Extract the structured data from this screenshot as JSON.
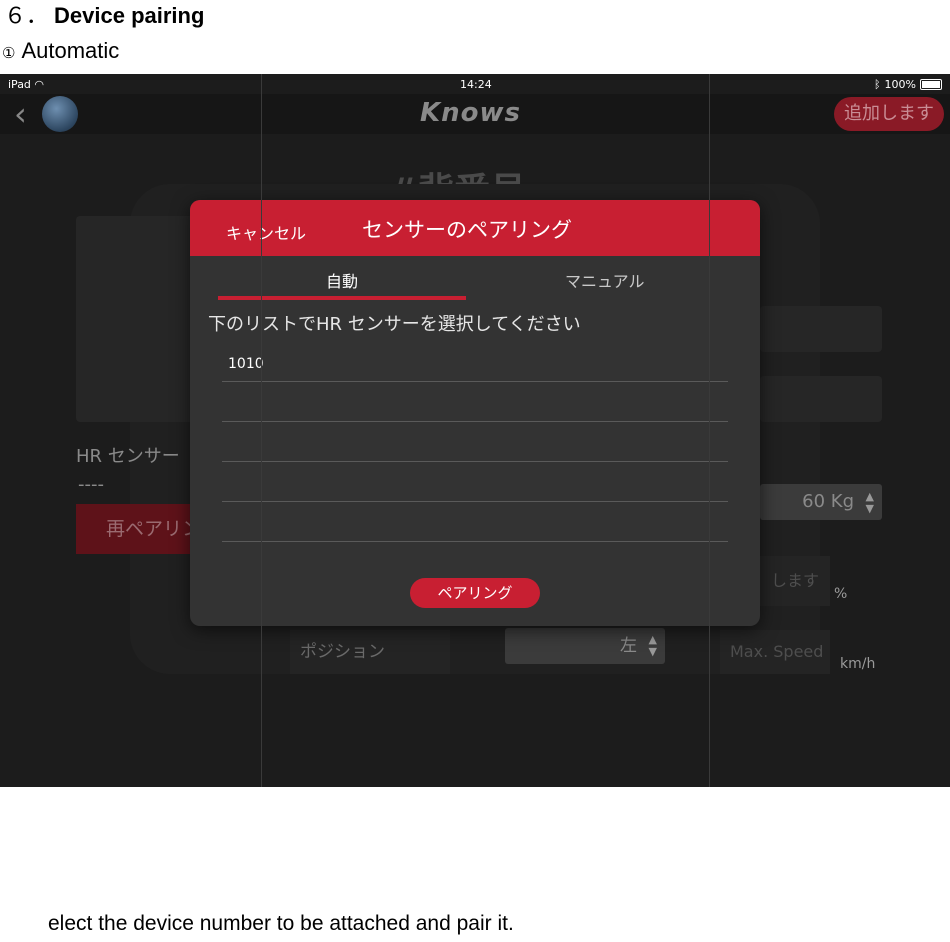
{
  "doc": {
    "heading_number": "６．",
    "heading_text": "Device pairing",
    "sub_marker": "①",
    "sub_text": "Automatic",
    "caption": "elect the device number to be attached and pair it."
  },
  "statusbar": {
    "device": "iPad",
    "time": "14:24",
    "battery": "100%"
  },
  "navbar": {
    "back_icon": "chevron-left-icon",
    "logo": "Knows",
    "add_button": "追加します"
  },
  "background": {
    "title": "#背番号",
    "hr_sensor_label": "HR センサー",
    "hr_sensor_value": "----",
    "repair_button": "再ペアリン",
    "weight_value": "60 Kg",
    "percent_unit": "%",
    "speed_unit": "km/h",
    "position_label": "ポジション",
    "side_value": "左",
    "max_speed_placeholder": "Max. Speed",
    "masu_fragment": "します"
  },
  "dialog": {
    "cancel": "キャンセル",
    "title": "センサーのペアリング",
    "tabs": [
      {
        "label": "自動",
        "active": true
      },
      {
        "label": "マニュアル",
        "active": false
      }
    ],
    "instruction": "下のリストでHR センサーを選択してください",
    "devices": [
      "1010",
      "",
      "",
      "",
      ""
    ],
    "pair_button": "ペアリング"
  },
  "colors": {
    "accent_red": "#c81f32",
    "dialog_bg": "#333333",
    "screen_bg": "#1c1c1c"
  }
}
